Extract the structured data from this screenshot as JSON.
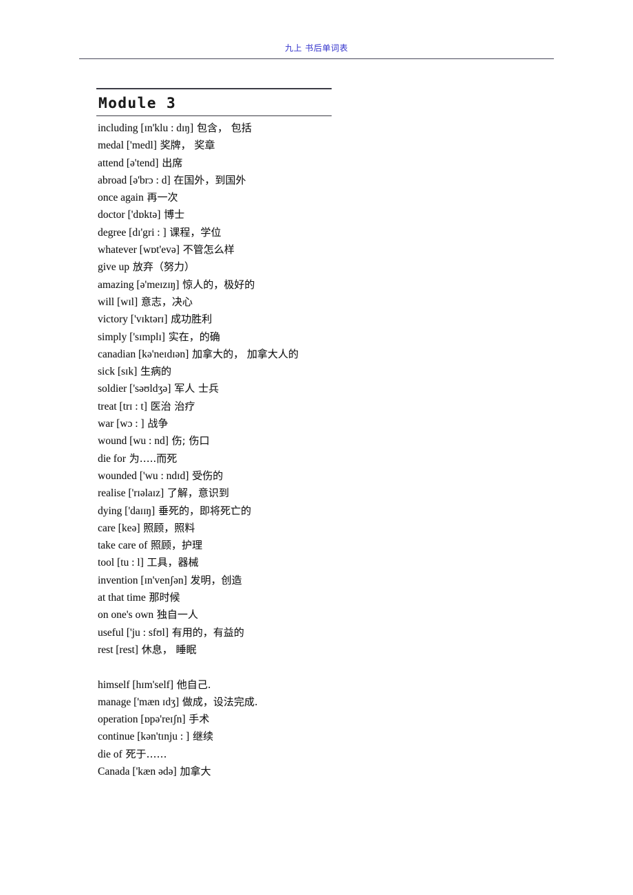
{
  "header": {
    "running_title": "九上 书后单词表"
  },
  "module": {
    "title": "Module 3"
  },
  "entries": [
    {
      "en": "including [ɪn'klu : dɪŋ]",
      "zh": "包含， 包括"
    },
    {
      "en": "medal ['medl]",
      "zh": "奖牌， 奖章"
    },
    {
      "en": "attend [ə'tend]",
      "zh": "出席"
    },
    {
      "en": "abroad [ə'brɔ : d]",
      "zh": "在国外，到国外"
    },
    {
      "en": "once again",
      "zh": "再一次"
    },
    {
      "en": "doctor ['dɒktə]",
      "zh": "博士"
    },
    {
      "en": "degree [dɪ'gri : ]",
      "zh": "课程，学位"
    },
    {
      "en": "whatever [wɒt'evə]",
      "zh": "不管怎么样"
    },
    {
      "en": "give up",
      "zh": "放弃（努力）"
    },
    {
      "en": "amazing [ə'meɪzɪŋ]",
      "zh": "惊人的，极好的"
    },
    {
      "en": "will [wɪl]",
      "zh": "意志，决心"
    },
    {
      "en": "victory ['vɪktərɪ]",
      "zh": "成功胜利"
    },
    {
      "en": "simply ['sɪmplɪ]",
      "zh": "实在，的确"
    },
    {
      "en": "canadian [kə'neɪdɪən]",
      "zh": "加拿大的，  加拿大人的"
    },
    {
      "en": "sick [sɪk]",
      "zh": "生病的"
    },
    {
      "en": "soldier ['səʊldʒə]",
      "zh": "军人 士兵"
    },
    {
      "en": "treat [trɪ : t]",
      "zh": "医治 治疗"
    },
    {
      "en": "war [wɔ : ]",
      "zh": "战争"
    },
    {
      "en": "wound [wu : nd]",
      "zh": "伤; 伤口"
    },
    {
      "en": "die for",
      "zh": "为…..而死"
    },
    {
      "en": "wounded ['wu : ndɪd]",
      "zh": "受伤的"
    },
    {
      "en": "realise ['rɪəlaɪz]",
      "zh": "了解，意识到"
    },
    {
      "en": "dying ['daɪɪŋ]",
      "zh": "垂死的，即将死亡的"
    },
    {
      "en": "care [keə]",
      "zh": "照顾，照料"
    },
    {
      "en": "take care of",
      "zh": "照顾，护理"
    },
    {
      "en": "tool [tu : l]",
      "zh": "工具，器械"
    },
    {
      "en": "invention [ɪn'venʃən]",
      "zh": "发明，创造"
    },
    {
      "en": "at that time",
      "zh": "那时候"
    },
    {
      "en": "on one's own",
      "zh": "独自一人"
    },
    {
      "en": "useful ['ju : sfʊl]",
      "zh": "有用的，有益的"
    },
    {
      "en": "rest [rest]",
      "zh": "休息， 睡眠"
    },
    {
      "spacer": true
    },
    {
      "en": "himself [hɪm'self]",
      "zh": "他自己."
    },
    {
      "en": "manage ['mæn ɪdʒ]",
      "zh": "做成，设法完成."
    },
    {
      "en": "operation [ɒpə'reɪʃn]",
      "zh": "手术"
    },
    {
      "en": "continue [kən'tɪnju : ]",
      "zh": "继续"
    },
    {
      "en": "die of",
      "zh": "死于……"
    },
    {
      "en": "Canada ['kæn ədə]",
      "zh": "加拿大"
    }
  ]
}
